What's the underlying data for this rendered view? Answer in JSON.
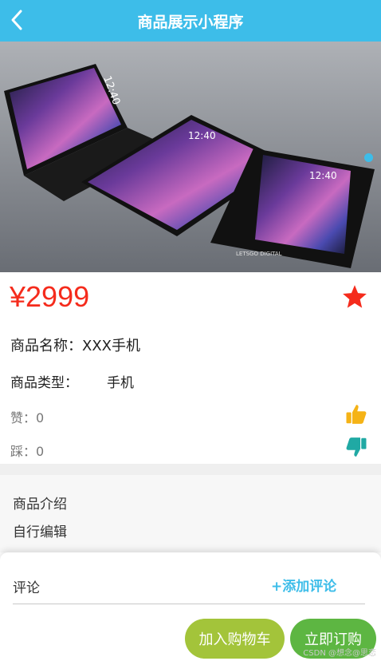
{
  "navbar": {
    "title": "商品展示小程序"
  },
  "product": {
    "price": "¥2999",
    "name_label": "商品名称：",
    "name_value": "XXX手机",
    "type_label": "商品类型：",
    "type_value": "手机",
    "like_label": "赞：",
    "like_count": "0",
    "dislike_label": "踩：",
    "dislike_count": "0"
  },
  "intro": {
    "title": "商品介绍",
    "body": "自行编辑"
  },
  "comments": {
    "label": "评论",
    "add_label": "+添加评论"
  },
  "actions": {
    "cart_label": "加入购物车",
    "buy_label": "立即订购"
  },
  "watermark": "CSDN @想念@思恋",
  "phone_screens": [
    "12:40",
    "12:40",
    "12:40"
  ],
  "phone_brand": "LETSGO DIGITAL",
  "colors": {
    "primary": "#3dbde9",
    "price": "#f52b1c",
    "favorite_star": "#f52b1c",
    "thumb_up": "#f5b316",
    "thumb_down": "#20a9a4",
    "cart_button": "#a3c43a",
    "buy_button": "#5db642"
  },
  "icons": {
    "back": "chevron-left",
    "favorite": "star",
    "like": "thumbs-up",
    "dislike": "thumbs-down"
  },
  "carousel": {
    "slide_count": 1,
    "active_index": 0
  }
}
